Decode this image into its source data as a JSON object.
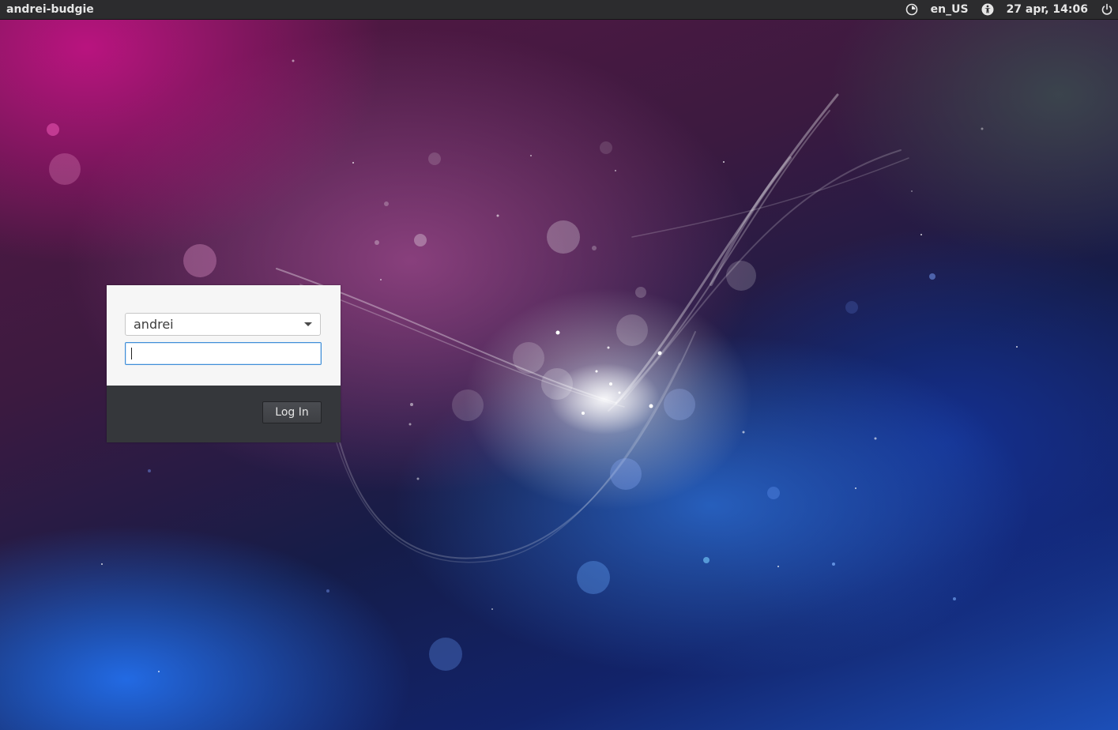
{
  "top_panel": {
    "hostname": "andrei-budgie",
    "keyboard_layout": "en_US",
    "datetime": "27 apr, 14:06",
    "icons": [
      "session-icon",
      "accessibility-icon",
      "power-icon"
    ]
  },
  "greeter": {
    "selected_user": "andrei",
    "password_value": "",
    "login_label": "Log In"
  },
  "colors": {
    "panel_bg": "#2c2c2e",
    "greeter_body_bg": "#f6f6f6",
    "greeter_footer_bg": "#35373b",
    "focus_accent": "#3f8ed8"
  }
}
